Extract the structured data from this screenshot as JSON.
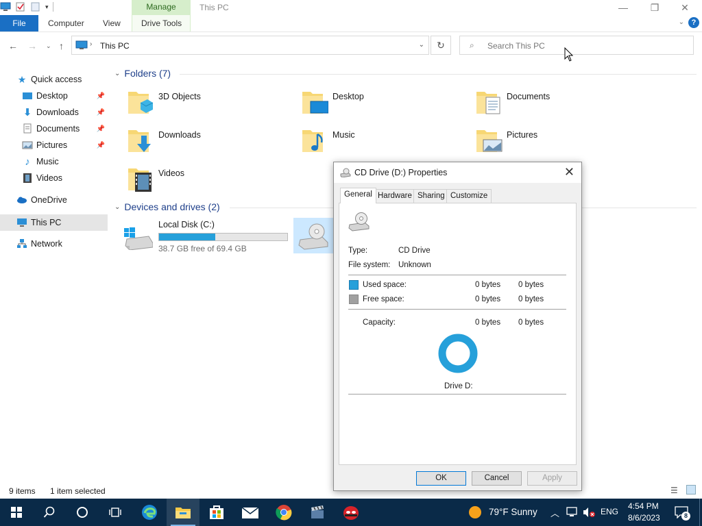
{
  "titlebar": {
    "manage_tab": "Manage",
    "window_title": "This PC"
  },
  "ribbon": {
    "file": "File",
    "computer": "Computer",
    "view": "View",
    "drive_tools": "Drive Tools",
    "help": "?"
  },
  "address": {
    "path": "This PC",
    "search_placeholder": "Search This PC"
  },
  "nav": {
    "quick_access": "Quick access",
    "desktop": "Desktop",
    "downloads": "Downloads",
    "documents": "Documents",
    "pictures": "Pictures",
    "music": "Music",
    "videos": "Videos",
    "onedrive": "OneDrive",
    "this_pc": "This PC",
    "network": "Network"
  },
  "folders": {
    "header": "Folders (7)",
    "items": [
      "3D Objects",
      "Desktop",
      "Documents",
      "Downloads",
      "Music",
      "Pictures",
      "Videos"
    ]
  },
  "drives": {
    "header": "Devices and drives (2)",
    "local_c": {
      "name": "Local Disk (C:)",
      "free": "38.7 GB free of 69.4 GB",
      "used_fraction": 0.44
    }
  },
  "status": {
    "items": "9 items",
    "selected": "1 item selected"
  },
  "dialog": {
    "title": "CD Drive (D:) Properties",
    "tabs": [
      "General",
      "Hardware",
      "Sharing",
      "Customize"
    ],
    "type_label": "Type:",
    "type_value": "CD Drive",
    "fs_label": "File system:",
    "fs_value": "Unknown",
    "used_label": "Used space:",
    "used_bytes": "0 bytes",
    "used_bytes2": "0 bytes",
    "free_label": "Free space:",
    "free_bytes": "0 bytes",
    "free_bytes2": "0 bytes",
    "capacity_label": "Capacity:",
    "capacity_bytes": "0 bytes",
    "capacity_bytes2": "0 bytes",
    "drive_label": "Drive D:",
    "ok": "OK",
    "cancel": "Cancel",
    "apply": "Apply",
    "used_color": "#26a0da",
    "free_color": "#a0a0a0"
  },
  "taskbar": {
    "weather": "79°F  Sunny",
    "lang": "ENG",
    "time": "4:54 PM",
    "date": "8/6/2023",
    "notifications": "8"
  }
}
